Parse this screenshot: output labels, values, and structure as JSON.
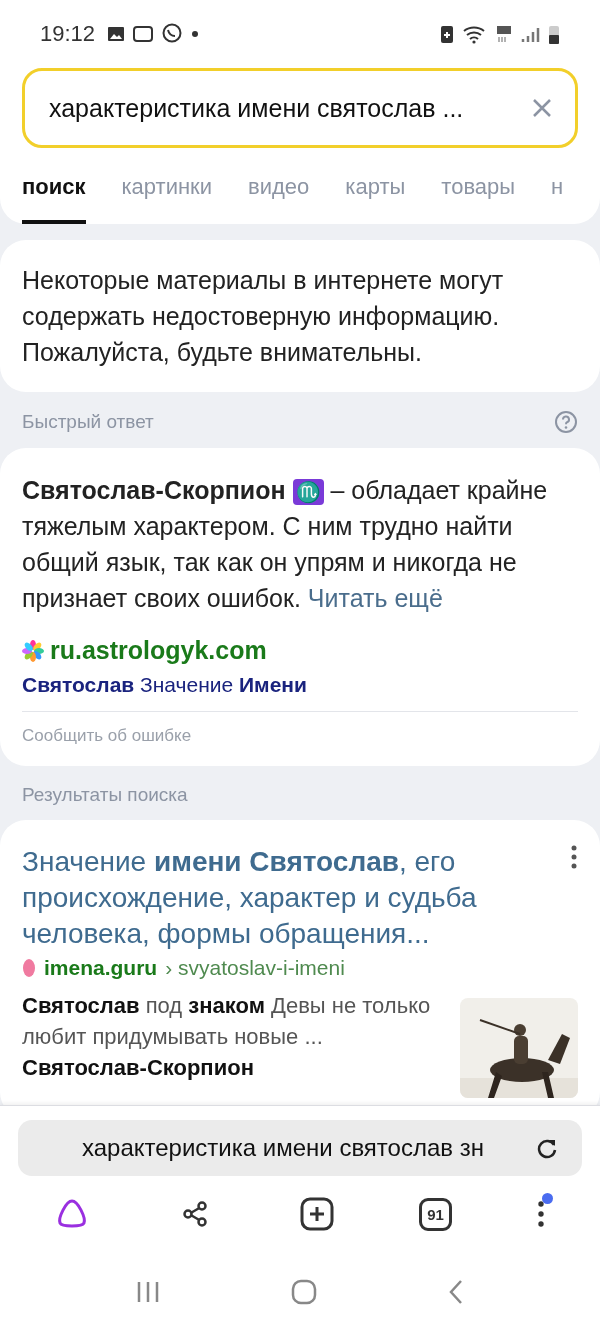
{
  "status_bar": {
    "time": "19:12"
  },
  "search": {
    "value": "характеристика имени святослав ..."
  },
  "tabs": [
    {
      "label": "поиск",
      "selected": true
    },
    {
      "label": "картинки",
      "selected": false
    },
    {
      "label": "видео",
      "selected": false
    },
    {
      "label": "карты",
      "selected": false
    },
    {
      "label": "товары",
      "selected": false
    },
    {
      "label": "н",
      "selected": false
    }
  ],
  "notice": "Некоторые материалы в интернете могут содержать недостоверную информацию. Пожалуйста, будьте внимательны.",
  "quick_answer": {
    "heading": "Быстрый ответ",
    "lead": "Святослав-Скорпион",
    "sign": "♏",
    "text": "– обладает крайне тяжелым характером. С ним трудно найти общий язык, так как он упрям и никогда не признает своих ошибок.",
    "link": "Читать ещё",
    "source": "ru.astrologyk.com",
    "source_title": "**Святослав** Значение **Имени**",
    "report": "Сообщить об ошибке"
  },
  "results": {
    "heading": "Результаты поиска",
    "items": [
      {
        "title": "Значение **имени Святослав**, его происхождение, характер и судьба человека, формы обращения...",
        "domain": "imena.guru",
        "path": "› svyatoslav-i-imeni",
        "snippet": "**Святослав** под **знаком** Девы не только любит придумывать новые ... **Святослав-Скорпион**"
      }
    ]
  },
  "address_bar": {
    "value": "характеристика имени святослав зн"
  },
  "toolbar": {
    "tab_count": "91"
  }
}
